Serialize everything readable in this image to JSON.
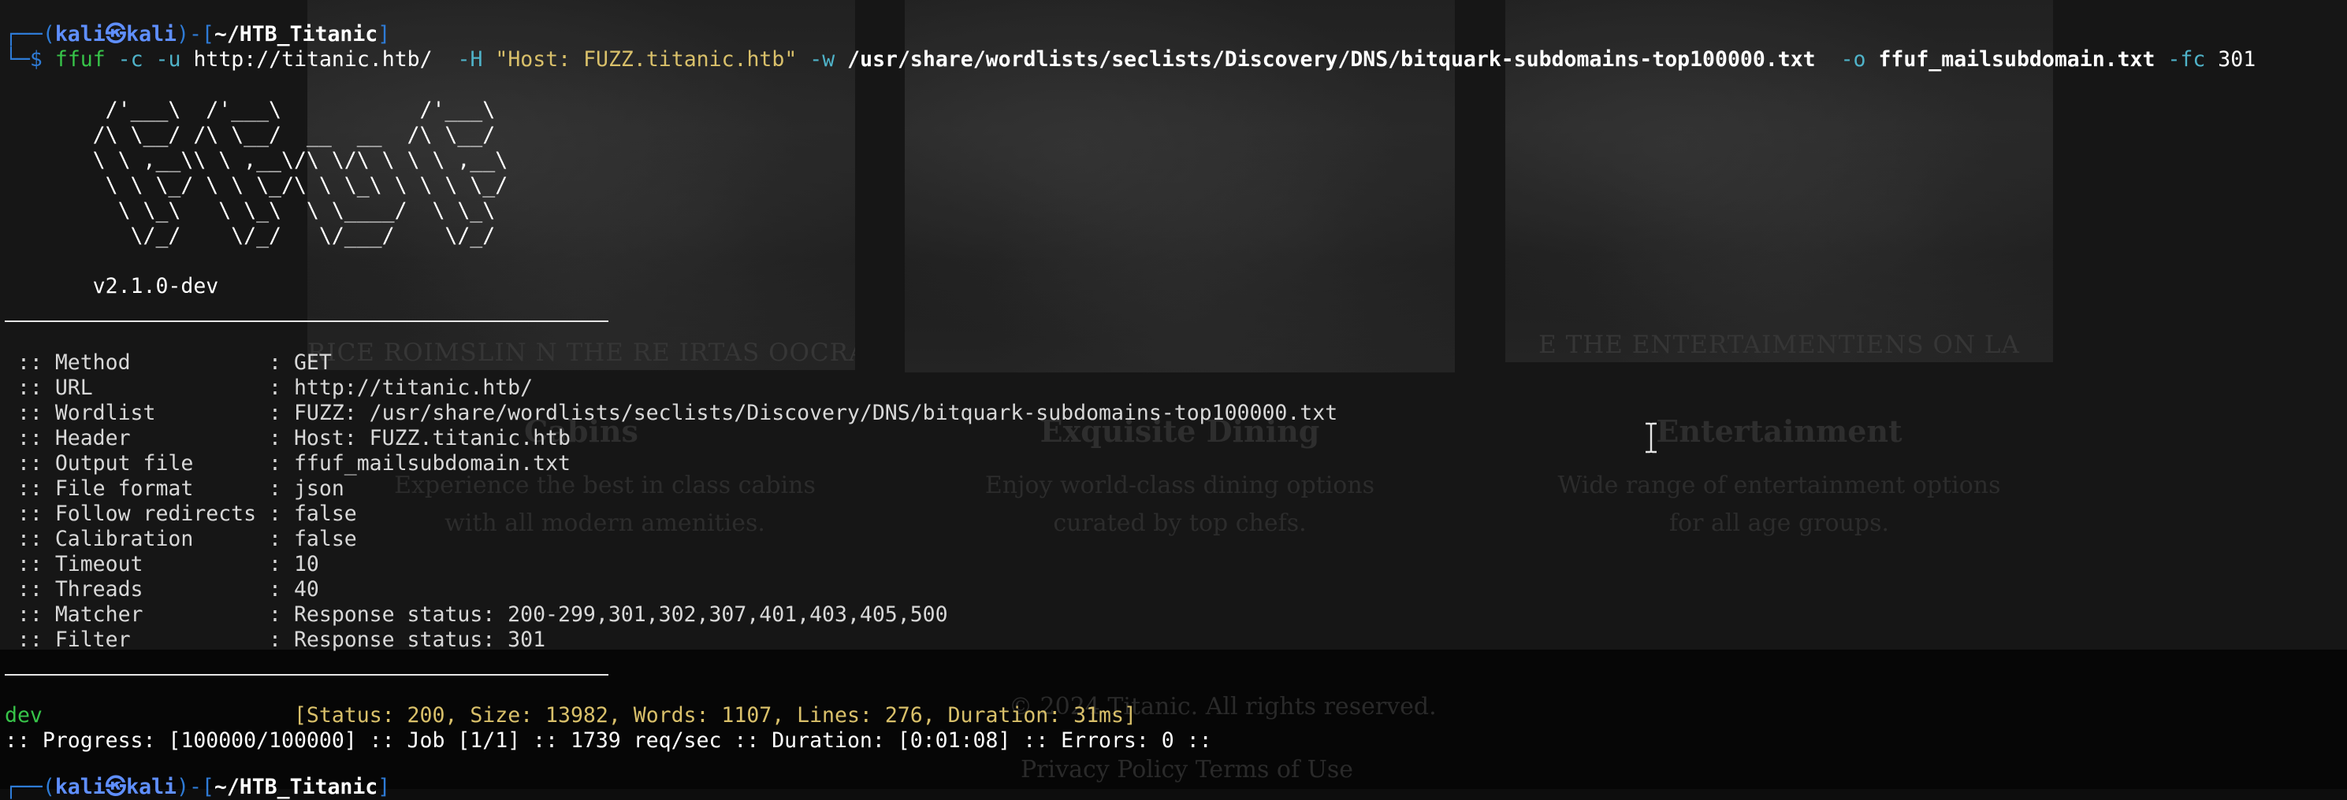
{
  "prompt_top": {
    "prefix": "┌──(",
    "user": "kali",
    "at": "㉿",
    "host": "kali",
    "mid": ")-[",
    "path": "~/HTB_Titanic",
    "suffix": "]"
  },
  "command": {
    "corner": "└─",
    "dollar": "$",
    "tool": "ffuf",
    "flag_c": "-c",
    "flag_u": "-u",
    "url": "http://titanic.htb/",
    "flag_H": "-H",
    "header": "\"Host: FUZZ.titanic.htb\"",
    "flag_w": "-w",
    "wordlist": "/usr/share/wordlists/seclists/Discovery/DNS/bitquark-subdomains-top100000.txt",
    "flag_o": "-o",
    "outfile": "ffuf_mailsubdomain.txt",
    "flag_fc": "-fc",
    "fc_value": "301"
  },
  "banner": {
    "art": [
      "        /'___\\  /'___\\           /'___\\",
      "       /\\ \\__/ /\\ \\__/  __  __  /\\ \\__/",
      "       \\ \\ ,__\\\\ \\ ,__\\/\\ \\/\\ \\ \\ \\ ,__\\",
      "        \\ \\ \\_/ \\ \\ \\_/\\ \\ \\_\\ \\ \\ \\ \\_/",
      "         \\ \\_\\   \\ \\_\\  \\ \\____/  \\ \\_\\",
      "          \\/_/    \\/_/   \\/___/    \\/_/"
    ],
    "version": "       v2.1.0-dev"
  },
  "config": [
    {
      "key": " :: Method           ",
      "value": ": GET"
    },
    {
      "key": " :: URL              ",
      "value": ": http://titanic.htb/"
    },
    {
      "key": " :: Wordlist         ",
      "value": ": FUZZ: /usr/share/wordlists/seclists/Discovery/DNS/bitquark-subdomains-top100000.txt"
    },
    {
      "key": " :: Header           ",
      "value": ": Host: FUZZ.titanic.htb"
    },
    {
      "key": " :: Output file      ",
      "value": ": ffuf_mailsubdomain.txt"
    },
    {
      "key": " :: File format      ",
      "value": ": json"
    },
    {
      "key": " :: Follow redirects ",
      "value": ": false"
    },
    {
      "key": " :: Calibration      ",
      "value": ": false"
    },
    {
      "key": " :: Timeout          ",
      "value": ": 10"
    },
    {
      "key": " :: Threads          ",
      "value": ": 40"
    },
    {
      "key": " :: Matcher          ",
      "value": ": Response status: 200-299,301,302,307,401,403,405,500"
    },
    {
      "key": " :: Filter           ",
      "value": ": Response status: 301"
    }
  ],
  "result": {
    "word": "dev",
    "status": "[Status: 200, Size: 13982, Words: 1107, Lines: 276, Duration: 31ms]"
  },
  "progress": ":: Progress: [100000/100000] :: Job [1/1] :: 1739 req/sec :: Duration: [0:01:08] :: Errors: 0 ::",
  "prompt_bottom": {
    "prefix": "┌──(",
    "user": "kali",
    "at": "㉿",
    "host": "kali",
    "mid": ")-[",
    "path": "~/HTB_Titanic",
    "suffix": "]"
  },
  "background_site": {
    "captions": [
      "RICE ROIMSLIN N THE RE IRTAS OOCRAST",
      "E THE ENTERTAIMENTIENS ON LA"
    ],
    "cards": [
      {
        "title": "Cabins",
        "text": "Experience the best in class cabins with all modern amenities."
      },
      {
        "title": "Exquisite Dining",
        "text": "Enjoy world-class dining options curated by top chefs."
      },
      {
        "title": "Entertainment",
        "text": "Wide range of entertainment options for all age groups."
      }
    ],
    "footer_copyright": "© 2024 Titanic. All rights reserved.",
    "footer_links": "Privacy Policy  Terms of Use"
  },
  "colors": {
    "prompt_frame": "#2e7bd6",
    "prompt_user": "#5f8fff",
    "command_tool": "#37c449",
    "string_arg": "#d9c06a",
    "flag": "#4fb3c9",
    "result_word": "#37c449"
  },
  "icons": {
    "text_cursor": "i-beam-cursor-icon"
  }
}
